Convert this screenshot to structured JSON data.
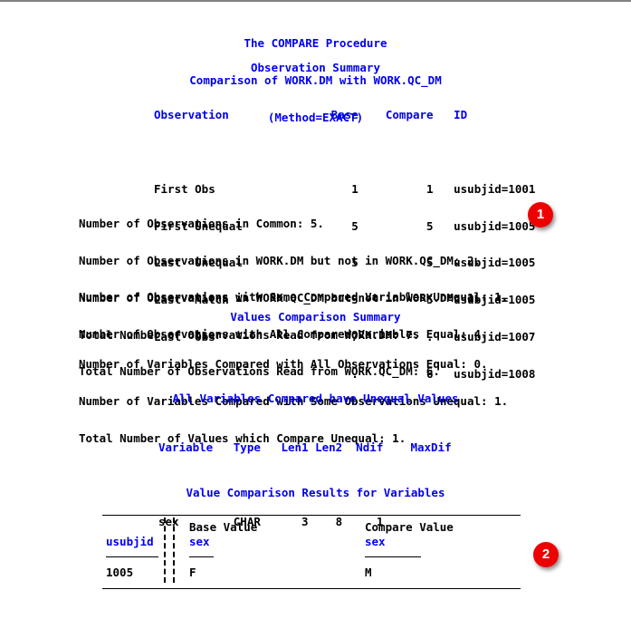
{
  "report": {
    "title_lines": [
      "The COMPARE Procedure",
      "Comparison of WORK.DM with WORK.QC_DM",
      "(Method=EXACT)"
    ],
    "observation_summary": {
      "heading": "Observation Summary",
      "columns": [
        "Observation",
        "Base",
        "Compare",
        "ID"
      ],
      "header_line": "Observation               Base    Compare   ID",
      "rows": [
        "First Obs                    1          1   usubjid=1001",
        "First Unequal                5          5   usubjid=1005",
        "Last  Unequal                5          5   usubjid=1005",
        "Last  Match                  5          5   usubjid=1005",
        "Last  Obs                    7          .   usubjid=1007",
        "                             .          6   usubjid=1008"
      ],
      "rows_data": [
        {
          "observation": "First Obs",
          "base": "1",
          "compare": "1",
          "id": "usubjid=1001"
        },
        {
          "observation": "First Unequal",
          "base": "5",
          "compare": "5",
          "id": "usubjid=1005"
        },
        {
          "observation": "Last  Unequal",
          "base": "5",
          "compare": "5",
          "id": "usubjid=1005"
        },
        {
          "observation": "Last  Match",
          "base": "5",
          "compare": "5",
          "id": "usubjid=1005"
        },
        {
          "observation": "Last  Obs",
          "base": "7",
          "compare": ".",
          "id": "usubjid=1007"
        },
        {
          "observation": "",
          "base": ".",
          "compare": "6",
          "id": "usubjid=1008"
        }
      ]
    },
    "counts_block_1": [
      "Number of Observations in Common: 5.",
      "Number of Observations in WORK.DM but not in WORK.QC_DM: 2.",
      "Number of Observations in WORK.QC_DM but not in WORK.DM: 1.",
      "Total Number of Observations Read from WORK.DM: 7.",
      "Total Number of Observations Read from WORK.QC_DM: 6."
    ],
    "counts_block_2": [
      "Number of Observations with Some Compared Variables Unequal: 1.",
      "Number of Observations with All Compared Variables Equal: 4."
    ],
    "values_comparison_summary": {
      "heading": "Values Comparison Summary",
      "lines": [
        "Number of Variables Compared with All Observations Equal: 0.",
        "Number of Variables Compared with Some Observations Unequal: 1.",
        "Total Number of Values which Compare Unequal: 1."
      ]
    },
    "unequal_variables": {
      "heading": "All Variables Compared have Unequal Values",
      "columns": [
        "Variable",
        "Type",
        "Len1",
        "Len2",
        "Ndif",
        "MaxDif"
      ],
      "header_line": "Variable   Type   Len1 Len2  Ndif    MaxDif",
      "rows": [
        "sex        CHAR      3    8     1"
      ],
      "rows_data": [
        {
          "variable": "sex",
          "type": "CHAR",
          "len1": "3",
          "len2": "8",
          "ndif": "1",
          "maxdif": ""
        }
      ]
    },
    "value_comparison_results": {
      "heading": "Value Comparison Results for Variables",
      "id_column_label": "usubjid",
      "base_group_label": "Base Value",
      "base_variable_label": "sex",
      "compare_group_label": "Compare Value",
      "compare_variable_label": "sex",
      "rows": [
        {
          "usubjid": "1005",
          "base_value": "F",
          "compare_value": "M"
        }
      ]
    }
  },
  "annotations": [
    {
      "label": "1",
      "color": "#ee0000"
    },
    {
      "label": "2",
      "color": "#ee0000"
    }
  ]
}
